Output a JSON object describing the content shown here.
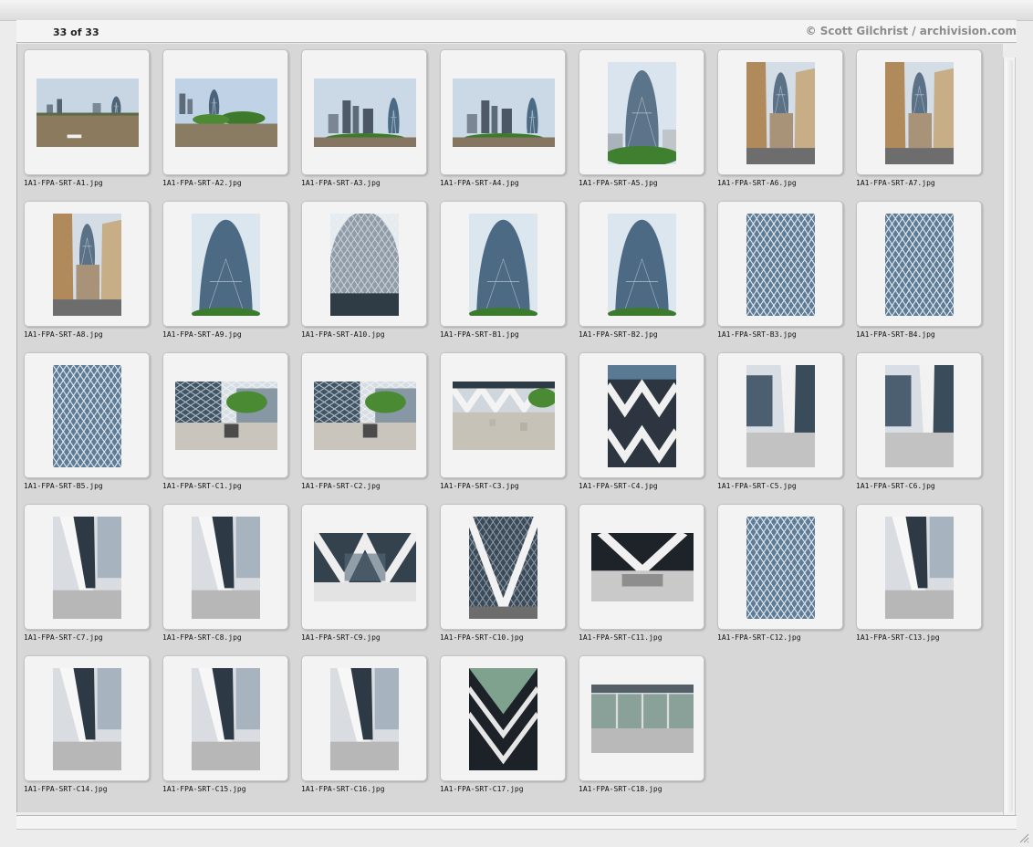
{
  "header": {
    "count_label": "33 of 33",
    "credit": "© Scott Gilchrist / archivision.com"
  },
  "thumbnails": [
    {
      "filename": "1A1-FPA-SRT-A1.jpg",
      "orientation": "landscape",
      "subject": "thames-skyline"
    },
    {
      "filename": "1A1-FPA-SRT-A2.jpg",
      "orientation": "landscape",
      "subject": "skyline-trees"
    },
    {
      "filename": "1A1-FPA-SRT-A3.jpg",
      "orientation": "landscape",
      "subject": "skyline"
    },
    {
      "filename": "1A1-FPA-SRT-A4.jpg",
      "orientation": "landscape",
      "subject": "skyline"
    },
    {
      "filename": "1A1-FPA-SRT-A5.jpg",
      "orientation": "portrait",
      "subject": "tower-trees"
    },
    {
      "filename": "1A1-FPA-SRT-A6.jpg",
      "orientation": "portrait",
      "subject": "street-view"
    },
    {
      "filename": "1A1-FPA-SRT-A7.jpg",
      "orientation": "portrait",
      "subject": "street-view"
    },
    {
      "filename": "1A1-FPA-SRT-A8.jpg",
      "orientation": "portrait",
      "subject": "street-view"
    },
    {
      "filename": "1A1-FPA-SRT-A9.jpg",
      "orientation": "portrait",
      "subject": "tower-close"
    },
    {
      "filename": "1A1-FPA-SRT-A10.jpg",
      "orientation": "portrait",
      "subject": "dome-up"
    },
    {
      "filename": "1A1-FPA-SRT-B1.jpg",
      "orientation": "portrait",
      "subject": "tower-close"
    },
    {
      "filename": "1A1-FPA-SRT-B2.jpg",
      "orientation": "portrait",
      "subject": "tower-close"
    },
    {
      "filename": "1A1-FPA-SRT-B3.jpg",
      "orientation": "portrait",
      "subject": "facade"
    },
    {
      "filename": "1A1-FPA-SRT-B4.jpg",
      "orientation": "portrait",
      "subject": "facade"
    },
    {
      "filename": "1A1-FPA-SRT-B5.jpg",
      "orientation": "portrait",
      "subject": "facade"
    },
    {
      "filename": "1A1-FPA-SRT-C1.jpg",
      "orientation": "landscape",
      "subject": "plaza"
    },
    {
      "filename": "1A1-FPA-SRT-C2.jpg",
      "orientation": "landscape",
      "subject": "plaza"
    },
    {
      "filename": "1A1-FPA-SRT-C3.jpg",
      "orientation": "landscape",
      "subject": "plaza-base"
    },
    {
      "filename": "1A1-FPA-SRT-C4.jpg",
      "orientation": "portrait",
      "subject": "base-chevrons"
    },
    {
      "filename": "1A1-FPA-SRT-C5.jpg",
      "orientation": "portrait",
      "subject": "base-street"
    },
    {
      "filename": "1A1-FPA-SRT-C6.jpg",
      "orientation": "portrait",
      "subject": "base-street"
    },
    {
      "filename": "1A1-FPA-SRT-C7.jpg",
      "orientation": "portrait",
      "subject": "column-detail"
    },
    {
      "filename": "1A1-FPA-SRT-C8.jpg",
      "orientation": "portrait",
      "subject": "column-detail"
    },
    {
      "filename": "1A1-FPA-SRT-C9.jpg",
      "orientation": "landscape",
      "subject": "entrance"
    },
    {
      "filename": "1A1-FPA-SRT-C10.jpg",
      "orientation": "portrait",
      "subject": "entrance-v"
    },
    {
      "filename": "1A1-FPA-SRT-C11.jpg",
      "orientation": "landscape",
      "subject": "entrance-dark"
    },
    {
      "filename": "1A1-FPA-SRT-C12.jpg",
      "orientation": "portrait",
      "subject": "facade"
    },
    {
      "filename": "1A1-FPA-SRT-C13.jpg",
      "orientation": "portrait",
      "subject": "column-detail"
    },
    {
      "filename": "1A1-FPA-SRT-C14.jpg",
      "orientation": "portrait",
      "subject": "column-detail"
    },
    {
      "filename": "1A1-FPA-SRT-C15.jpg",
      "orientation": "portrait",
      "subject": "column-detail"
    },
    {
      "filename": "1A1-FPA-SRT-C16.jpg",
      "orientation": "portrait",
      "subject": "column-detail"
    },
    {
      "filename": "1A1-FPA-SRT-C17.jpg",
      "orientation": "portrait",
      "subject": "lobby-ceiling"
    },
    {
      "filename": "1A1-FPA-SRT-C18.jpg",
      "orientation": "landscape",
      "subject": "lobby"
    }
  ]
}
